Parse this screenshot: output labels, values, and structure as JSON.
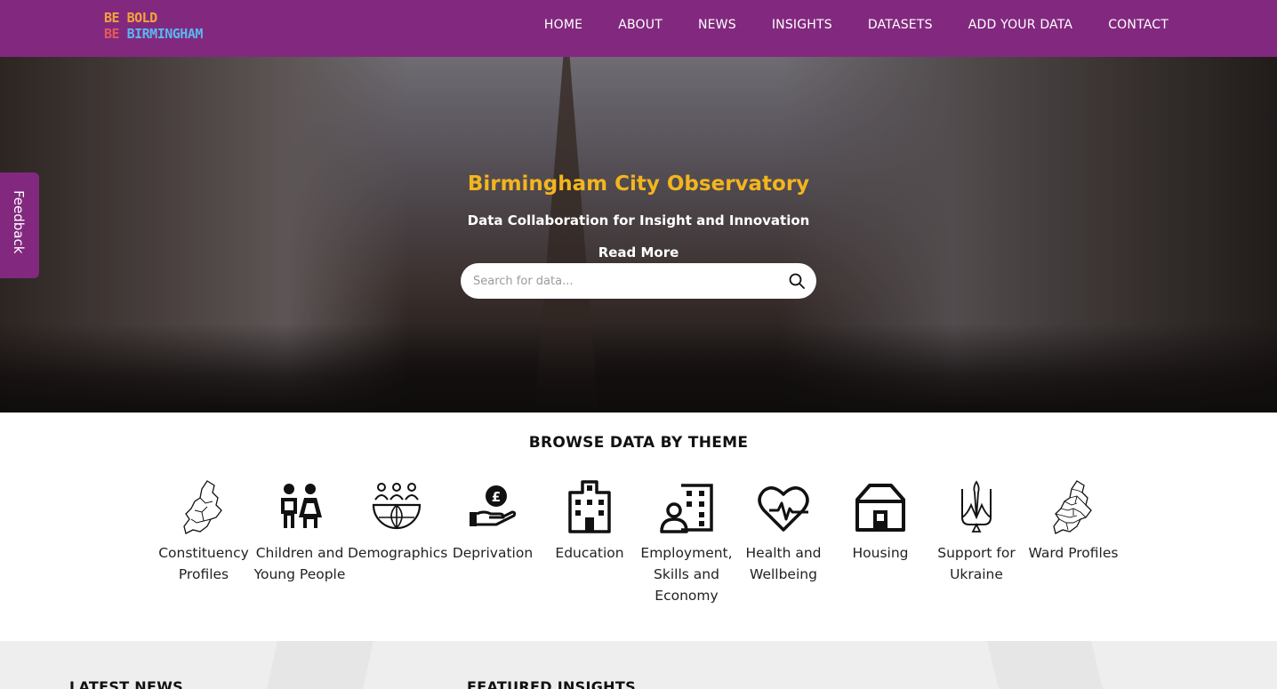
{
  "header": {
    "logo": {
      "line1_a": "BE",
      "line1_b": "BOLD",
      "line2_a": "BE",
      "line2_b": "BIRMINGHAM"
    },
    "nav": [
      "HOME",
      "ABOUT",
      "NEWS",
      "INSIGHTS",
      "DATASETS",
      "ADD YOUR DATA",
      "CONTACT"
    ]
  },
  "hero": {
    "title": "Birmingham City Observatory",
    "subtitle": "Data Collaboration for Insight and Innovation",
    "read_more": "Read More",
    "search_placeholder": "Search for data...",
    "search_value": ""
  },
  "feedback": {
    "label": "Feedback"
  },
  "themes": {
    "title": "BROWSE DATA BY THEME",
    "items": [
      {
        "label": "Constituency Profiles",
        "icon": "constituency-map-icon"
      },
      {
        "label": "Children and Young People",
        "icon": "children-icon"
      },
      {
        "label": "Demographics",
        "icon": "globe-people-icon"
      },
      {
        "label": "Deprivation",
        "icon": "hand-pound-icon"
      },
      {
        "label": "Education",
        "icon": "school-building-icon"
      },
      {
        "label": "Employment, Skills and Economy",
        "icon": "worker-building-icon"
      },
      {
        "label": "Health and Wellbeing",
        "icon": "heart-pulse-icon"
      },
      {
        "label": "Housing",
        "icon": "house-icon"
      },
      {
        "label": "Support for Ukraine",
        "icon": "ukraine-trident-icon"
      },
      {
        "label": "Ward Profiles",
        "icon": "ward-map-icon"
      }
    ]
  },
  "sections": {
    "latest_news": "LATEST NEWS",
    "featured_insights": "FEATURED INSIGHTS"
  },
  "colors": {
    "brand_purple": "#82297f",
    "title_gold": "#f3b51e"
  }
}
